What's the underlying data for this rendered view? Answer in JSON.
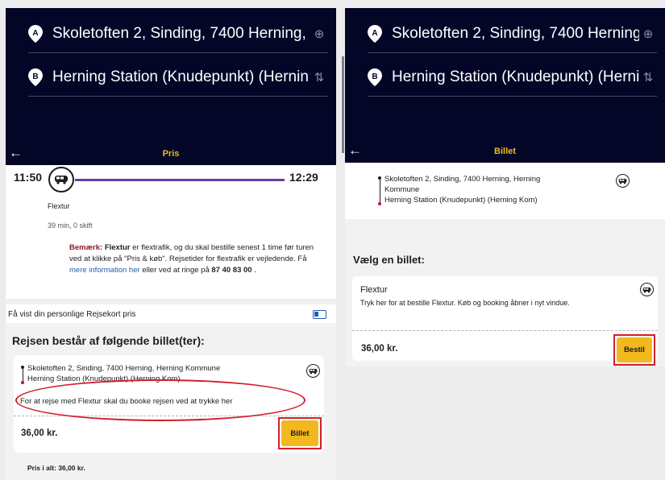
{
  "left": {
    "from": "Skoletoften 2, Sinding, 7400 Herning,",
    "to": "Herning Station (Knudepunkt) (Hernin",
    "pin_a": "A",
    "pin_b": "B",
    "title": "Pris",
    "start_time": "11:50",
    "end_time": "12:29",
    "line": "Flextur",
    "duration": "39 min, 0 skift",
    "note": {
      "label": "Bemærk:",
      "text1": " ",
      "brand": "Flextur",
      "text2": " er flextrafik, og du skal bestille senest 1 time før turen ved at klikke på \"Pris & køb\". Rejsetider for flextrafik er vejledende. Få ",
      "link": "mere information her",
      "text3": " eller ved at ringe på ",
      "phone": "87 40 83 00",
      "text4": " ."
    },
    "rejsekort_label": "Få vist din personlige Rejsekort pris",
    "section_title": "Rejsen består af følgende billet(ter):",
    "stop_from": "Skoletoften 2, Sinding, 7400 Herning, Herning Kommune",
    "stop_to": "Herning Station (Knudepunkt) (Herning Kom)",
    "booking_note": "For at rejse med Flextur skal du booke rejsen ved at trykke her",
    "price": "36,00 kr.",
    "button": "Billet",
    "total": "Pris i alt: 36,00 kr."
  },
  "right": {
    "from": "Skoletoften 2, Sinding, 7400 Herning,",
    "to": "Herning Station (Knudepunkt) (Hernin",
    "pin_a": "A",
    "pin_b": "B",
    "title": "Billet",
    "stop_from_1": "Skoletoften 2, Sinding, 7400 Herning, Herning",
    "stop_from_2": "Kommune",
    "stop_to": "Herning Station (Knudepunkt) (Herning Kom)",
    "section_title": "Vælg en billet:",
    "card_title": "Flextur",
    "card_desc": "Tryk her for at bestille Flextur. Køb og booking åbner i nyt vindue.",
    "price": "36,00 kr.",
    "button": "Bestil"
  },
  "icons": {
    "back": "←",
    "locate": "⊕",
    "swap": "⇅"
  },
  "colors": {
    "header_bg": "#040628",
    "accent_yellow": "#f2b81d",
    "route_purple": "#6a3fa3",
    "highlight_red": "#d21f2b"
  }
}
